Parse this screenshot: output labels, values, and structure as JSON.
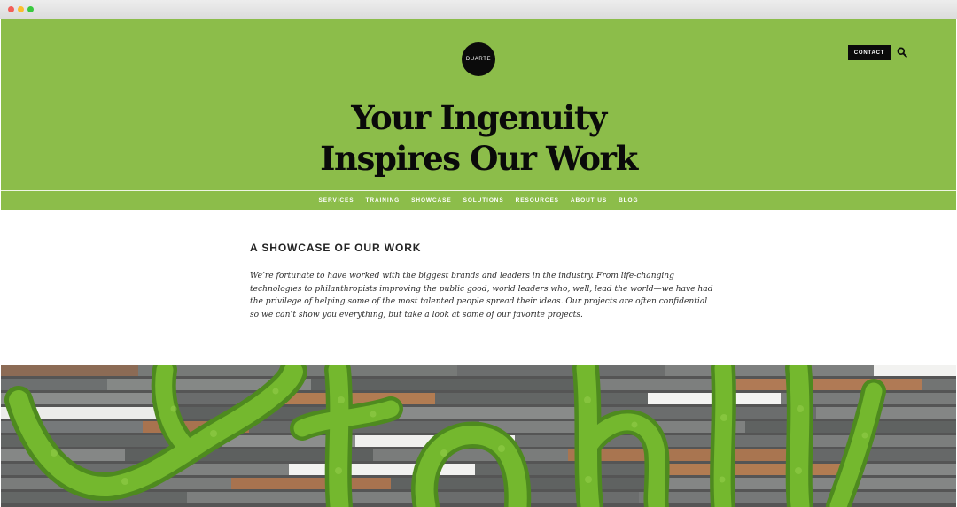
{
  "colors": {
    "brand_green": "#8cbd4a",
    "black": "#0b0b0b",
    "nav_text": "#ffffff",
    "moss_green": "#74b82e"
  },
  "header": {
    "logo_text": "DUARTE",
    "contact_label": "CONTACT",
    "search_icon": "search-icon"
  },
  "hero": {
    "headline_line1": "Your Ingenuity",
    "headline_line2": "Inspires Our Work"
  },
  "nav": {
    "items": [
      {
        "label": "SERVICES"
      },
      {
        "label": "TRAINING"
      },
      {
        "label": "SHOWCASE"
      },
      {
        "label": "SOLUTIONS"
      },
      {
        "label": "RESOURCES"
      },
      {
        "label": "ABOUT US"
      },
      {
        "label": "BLOG"
      }
    ]
  },
  "main": {
    "section_title": "A SHOWCASE OF OUR WORK",
    "intro_text": "We’re fortunate to have worked with the biggest brands and leaders in the industry. From life-changing technologies to philanthropists improving the public good, world leaders who, well, lead the world—we have had the privilege of helping some of the most talented people spread their ideas. Our projects are often confidential so we can’t show you everything, but take a look at some of our favorite projects."
  },
  "image": {
    "description_icon": "moss-wall-image"
  }
}
